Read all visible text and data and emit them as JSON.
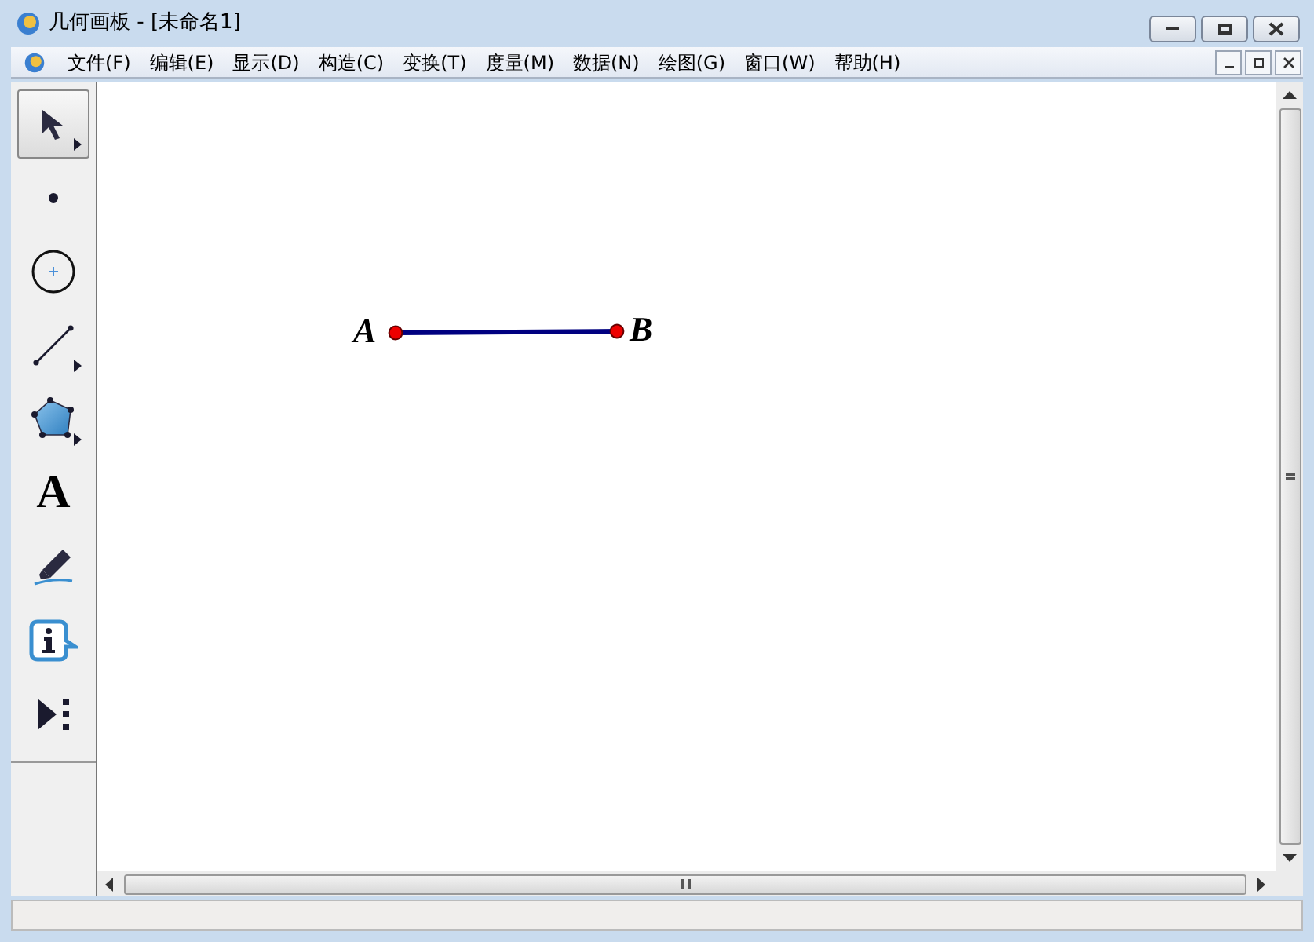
{
  "window": {
    "title": "几何画板 - [未命名1]"
  },
  "menu": [
    "文件(F)",
    "编辑(E)",
    "显示(D)",
    "构造(C)",
    "变换(T)",
    "度量(M)",
    "数据(N)",
    "绘图(G)",
    "窗口(W)",
    "帮助(H)"
  ],
  "tools": [
    {
      "kind": "arrow",
      "selected": true
    },
    {
      "kind": "point",
      "selected": false
    },
    {
      "kind": "compass",
      "selected": false
    },
    {
      "kind": "line",
      "selected": false
    },
    {
      "kind": "polygon",
      "selected": false
    },
    {
      "kind": "text",
      "glyph": "A",
      "selected": false
    },
    {
      "kind": "marker",
      "selected": false
    },
    {
      "kind": "info",
      "selected": false
    },
    {
      "kind": "custom",
      "selected": false
    }
  ],
  "canvas": {
    "points": [
      {
        "label": "A"
      },
      {
        "label": "B"
      }
    ]
  }
}
